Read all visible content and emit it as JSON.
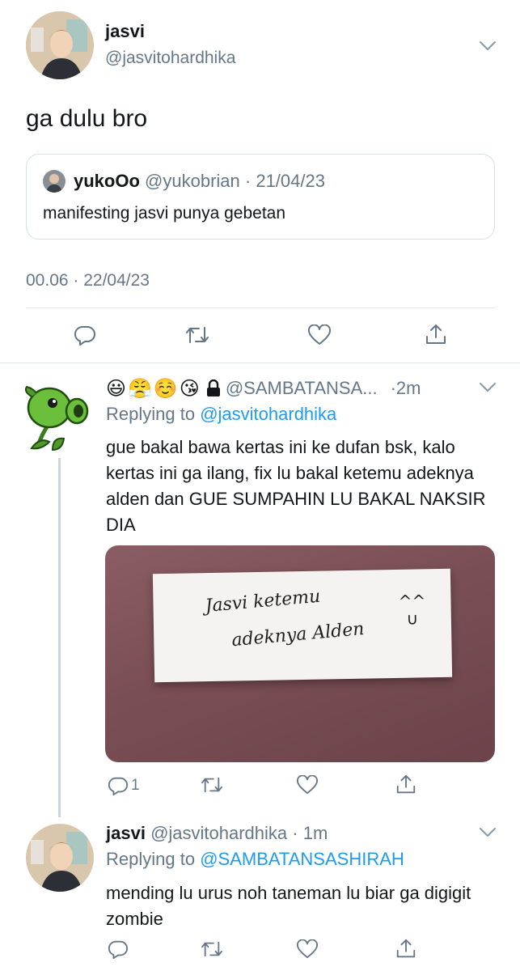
{
  "main_tweet": {
    "name": "jasvi",
    "handle": "@jasvitohardhika",
    "text": "ga dulu bro",
    "quoted": {
      "name": "yukoOo",
      "handle": "@yukobrian",
      "date": "· 21/04/23",
      "text": "manifesting jasvi punya gebetan"
    },
    "timestamp": "00.06 · 22/04/23"
  },
  "reply1": {
    "emojis": "😃😤☺️😘",
    "handle": "@SAMBATANSA...",
    "time": "·2m",
    "replying_prefix": "Replying to",
    "replying_to": "@jasvitohardhika",
    "text": "gue bakal bawa kertas ini ke dufan bsk, kalo kertas ini ga ilang, fix lu bakal ketemu adeknya alden dan GUE SUMPAHIN LU BAKAL NAKSIR DIA",
    "image_note_line1": "Jasvi ketemu",
    "image_note_line2": "adeknya Alden",
    "image_note_face": "^^\n∪",
    "reply_count": "1"
  },
  "reply2": {
    "name": "jasvi",
    "handle": "@jasvitohardhika",
    "time": "· 1m",
    "replying_prefix": "Replying to",
    "replying_to": "@SAMBATANSASHIRAH",
    "text": "mending lu urus noh taneman lu biar ga digigit zombie"
  },
  "colors": {
    "link_blue": "#1d9bf0",
    "secondary_text": "#657786",
    "divider": "#e1e8ed",
    "thread_line": "#ccd6dd"
  },
  "icons": [
    "chevron-down-icon",
    "reply-icon",
    "retweet-icon",
    "like-icon",
    "share-icon",
    "lock-icon"
  ]
}
